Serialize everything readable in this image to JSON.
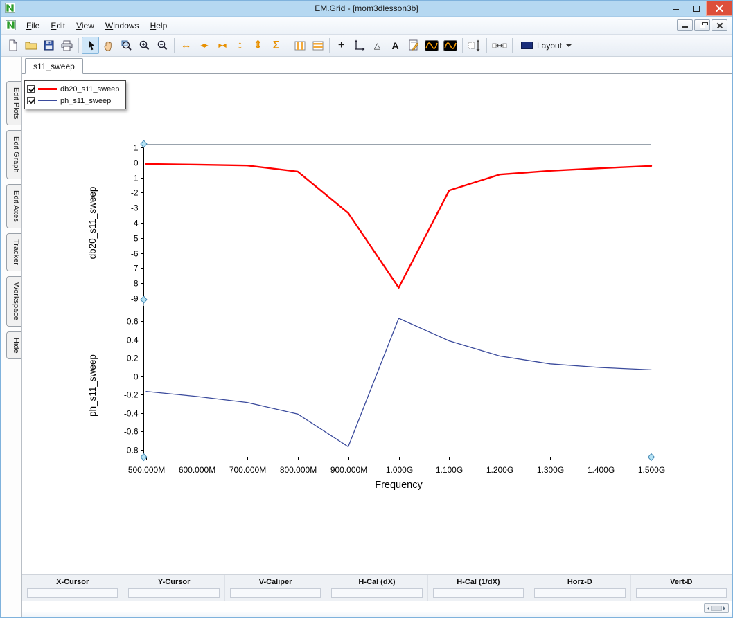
{
  "window": {
    "title": "EM.Grid - [mom3dlesson3b]",
    "controls": [
      {
        "name": "minimize"
      },
      {
        "name": "maximize"
      },
      {
        "name": "close"
      }
    ]
  },
  "menu": {
    "items": [
      {
        "label": "File",
        "u": 0
      },
      {
        "label": "Edit",
        "u": 0
      },
      {
        "label": "View",
        "u": 0
      },
      {
        "label": "Windows",
        "u": 0
      },
      {
        "label": "Help",
        "u": 0
      }
    ]
  },
  "mdi": {
    "buttons": [
      {
        "name": "minimize"
      },
      {
        "name": "restore"
      },
      {
        "name": "close"
      }
    ]
  },
  "toolbar": {
    "items": [
      {
        "name": "new",
        "icon": "page"
      },
      {
        "name": "open",
        "icon": "folder"
      },
      {
        "name": "save",
        "icon": "floppy"
      },
      {
        "name": "print",
        "icon": "printer"
      },
      {
        "sep": true
      },
      {
        "name": "select-pointer",
        "icon": "pointer",
        "selected": true
      },
      {
        "name": "pan",
        "icon": "hand"
      },
      {
        "name": "zoom-window",
        "icon": "zoomwin"
      },
      {
        "name": "zoom-in",
        "icon": "zoomin"
      },
      {
        "name": "zoom-out",
        "icon": "zoomout"
      },
      {
        "sep": true
      },
      {
        "name": "expand-x-axis",
        "glyph": "↔",
        "cls": "org big"
      },
      {
        "name": "scroll-x-axis",
        "glyph": "◀▶",
        "cls": "org sm"
      },
      {
        "name": "fit-x-axis",
        "glyph": "▶◀",
        "cls": "org sm"
      },
      {
        "name": "expand-y-axis",
        "glyph": "↕",
        "cls": "org big"
      },
      {
        "name": "scroll-y-axis",
        "glyph": "⇕",
        "cls": "org big"
      },
      {
        "name": "autoscale-sum",
        "glyph": "Σ",
        "cls": "org big"
      },
      {
        "sep": true
      },
      {
        "name": "stacked-plot-columns",
        "icon": "cols"
      },
      {
        "name": "stacked-plot-rows",
        "icon": "rows"
      },
      {
        "sep": true
      },
      {
        "name": "add-cursor",
        "glyph": "+",
        "cls": "blk big"
      },
      {
        "name": "axes-options",
        "icon": "axes"
      },
      {
        "name": "delta-readout",
        "glyph": "△",
        "cls": "blk"
      },
      {
        "name": "add-text",
        "glyph": "A",
        "cls": "blk bold"
      },
      {
        "name": "notes-editor",
        "icon": "notes"
      },
      {
        "name": "waveform-options-1",
        "icon": "wave"
      },
      {
        "name": "waveform-options-2",
        "icon": "wave"
      },
      {
        "sep": true
      },
      {
        "name": "vertical-limits",
        "icon": "vfit"
      },
      {
        "sep": true
      },
      {
        "name": "horizontal-limits",
        "icon": "hfit"
      },
      {
        "sep": true
      },
      {
        "name": "layout",
        "icon": "layoutbox",
        "label": "Layout",
        "dropdown": true
      }
    ]
  },
  "side_tabs": [
    "Edit Plots",
    "Edit Graph",
    "Edit Axes",
    "Tracker",
    "Workspace",
    "Hide"
  ],
  "doc_tab": "s11_sweep",
  "legend": {
    "items": [
      {
        "label": "db20_s11_sweep",
        "color": "#ff0000",
        "checked": true,
        "line_width": 3
      },
      {
        "label": "ph_s11_sweep",
        "color": "#3a4a9c",
        "checked": true,
        "line_width": 1
      }
    ]
  },
  "chart_data": [
    {
      "type": "line",
      "ylabel": "db20_s11_sweep",
      "x": [
        500,
        600,
        700,
        800,
        900,
        1000,
        1100,
        1200,
        1300,
        1400,
        1500
      ],
      "x_unit": "MHz",
      "series": [
        {
          "name": "db20_s11_sweep",
          "color": "#ff0000",
          "stroke_width": 2.4,
          "values": [
            -0.1,
            -0.14,
            -0.2,
            -0.6,
            -3.35,
            -8.3,
            -1.85,
            -0.8,
            -0.55,
            -0.38,
            -0.23
          ]
        }
      ],
      "ylim": [
        -9,
        1
      ],
      "yticks": [
        1,
        0,
        -1,
        -2,
        -3,
        -4,
        -5,
        -6,
        -7,
        -8,
        -9
      ],
      "ytick_labels": [
        "1",
        "0",
        "-1",
        "-2",
        "-3",
        "-4",
        "-5",
        "-6",
        "-7",
        "-8",
        "-9"
      ],
      "grid": false,
      "legend_position": "top-left-floating"
    },
    {
      "type": "line",
      "ylabel": "ph_s11_sweep",
      "xlabel": "Frequency",
      "x": [
        500,
        600,
        700,
        800,
        900,
        1000,
        1100,
        1200,
        1300,
        1400,
        1500
      ],
      "x_tick_labels": [
        "500.000M",
        "600.000M",
        "700.000M",
        "800.000M",
        "900.000M",
        "1.000G",
        "1.100G",
        "1.200G",
        "1.300G",
        "1.400G",
        "1.500G"
      ],
      "series": [
        {
          "name": "ph_s11_sweep",
          "color": "#3a4a9c",
          "stroke_width": 1.3,
          "values": [
            -0.165,
            -0.22,
            -0.285,
            -0.41,
            -0.765,
            0.63,
            0.385,
            0.22,
            0.135,
            0.095,
            0.07
          ]
        }
      ],
      "ylim": [
        -0.9,
        0.7
      ],
      "yticks": [
        0.6,
        0.4,
        0.2,
        0,
        -0.2,
        -0.4,
        -0.6,
        -0.8
      ],
      "ytick_labels": [
        "0.6",
        "0.4",
        "0.2",
        "0",
        "-0.2",
        "-0.4",
        "-0.6",
        "-0.8"
      ],
      "grid": false
    }
  ],
  "cursor_bar": {
    "columns": [
      "X-Cursor",
      "Y-Cursor",
      "V-Caliper",
      "H-Cal (dX)",
      "H-Cal (1/dX)",
      "Horz-D",
      "Vert-D"
    ],
    "values": [
      "",
      "",
      "",
      "",
      "",
      "",
      ""
    ]
  }
}
